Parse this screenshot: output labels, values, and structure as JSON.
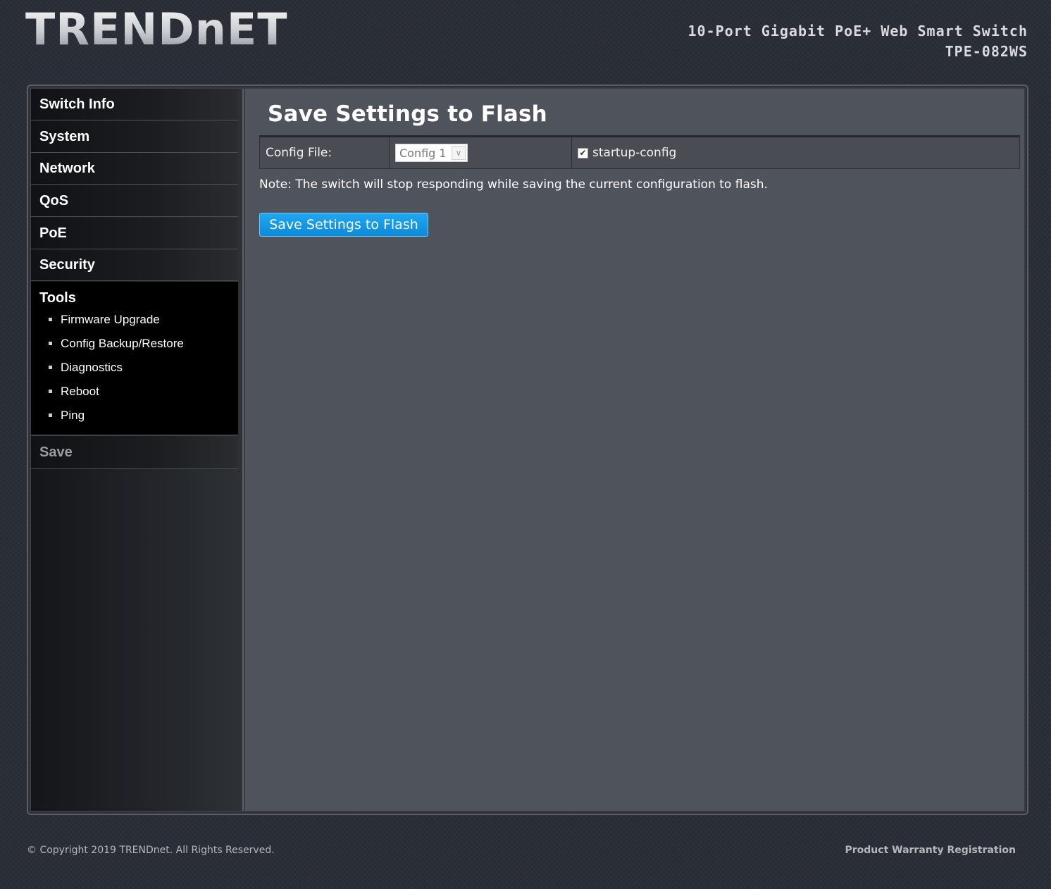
{
  "header": {
    "logo_text": "TRENDnET",
    "product_name": "10-Port Gigabit PoE+ Web Smart Switch",
    "model": "TPE-082WS"
  },
  "sidebar": {
    "items": [
      {
        "label": "Switch Info"
      },
      {
        "label": "System"
      },
      {
        "label": "Network"
      },
      {
        "label": "QoS"
      },
      {
        "label": "PoE"
      },
      {
        "label": "Security"
      }
    ],
    "tools": {
      "label": "Tools",
      "subitems": [
        {
          "label": "Firmware Upgrade"
        },
        {
          "label": "Config Backup/Restore"
        },
        {
          "label": "Diagnostics"
        },
        {
          "label": "Reboot"
        },
        {
          "label": "Ping"
        }
      ]
    },
    "save_label": "Save"
  },
  "main": {
    "title": "Save Settings to Flash",
    "config_label": "Config File:",
    "config_select_value": "Config 1",
    "checkbox_label": "startup-config",
    "checkbox_checked": true,
    "note": "Note: The switch will stop responding while saving the current configuration to flash.",
    "button_label": "Save Settings to Flash"
  },
  "footer": {
    "copyright": "© Copyright 2019 TRENDnet. All Rights Reserved.",
    "warranty_link": "Product Warranty Registration"
  },
  "colors": {
    "accent_button": "#0b8ad9",
    "content_bg": "#4f535b",
    "sidebar_active_bg": "#000000"
  }
}
